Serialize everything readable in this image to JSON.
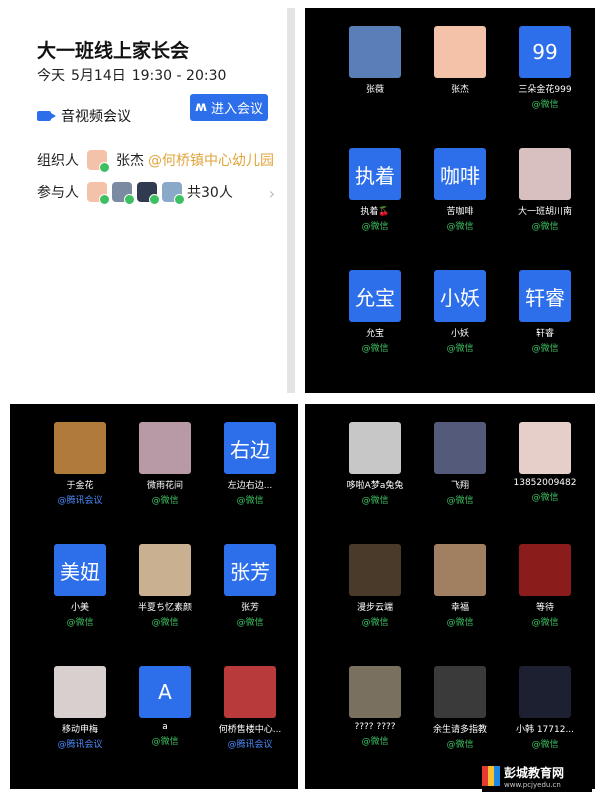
{
  "meeting": {
    "title": "大一班线上家长会",
    "date_day": "今天",
    "date": "5月14日",
    "time": "19:30 - 20:30",
    "type_label": "音视频会议",
    "join_label": "进入会议",
    "organizer_label": "组织人",
    "organizer_name": "张杰",
    "organizer_org": "@何桥镇中心幼儿园",
    "participants_label": "参与人",
    "participants_count": "共30人",
    "accent": "#2d6fea"
  },
  "grid1": [
    {
      "name": "张薇",
      "src": "",
      "thumb": "photo",
      "color": "#5a7fb8"
    },
    {
      "name": "张杰",
      "src": "",
      "thumb": "photo",
      "color": "#f3c2a8"
    },
    {
      "name": "三朵金花999",
      "src": "@微信",
      "thumb": "99",
      "color": "#2d6fea"
    },
    {
      "name": "执着🍒",
      "src": "@微信",
      "thumb": "执着",
      "color": "#2d6fea"
    },
    {
      "name": "苦咖啡",
      "src": "@微信",
      "thumb": "咖啡",
      "color": "#2d6fea"
    },
    {
      "name": "大一班胡川南",
      "src": "@微信",
      "thumb": "photo",
      "color": "#d8c0c0"
    },
    {
      "name": "允宝",
      "src": "@微信",
      "thumb": "允宝",
      "color": "#2d6fea"
    },
    {
      "name": "小妖",
      "src": "@微信",
      "thumb": "小妖",
      "color": "#2d6fea"
    },
    {
      "name": "轩睿",
      "src": "@微信",
      "thumb": "轩睿",
      "color": "#2d6fea"
    }
  ],
  "grid2": [
    {
      "name": "于金花",
      "src": "@腾讯会议",
      "thumb": "photo",
      "color": "#b07a3a"
    },
    {
      "name": "微雨花间",
      "src": "@微信",
      "thumb": "photo",
      "color": "#b89aa6"
    },
    {
      "name": "左边右边...",
      "src": "@微信",
      "thumb": "右边",
      "color": "#2d6fea"
    },
    {
      "name": "小美",
      "src": "@微信",
      "thumb": "美妞",
      "color": "#2d6fea"
    },
    {
      "name": "半夏ち忆素颜",
      "src": "@微信",
      "thumb": "photo",
      "color": "#c9b090"
    },
    {
      "name": "张芳",
      "src": "@微信",
      "thumb": "张芳",
      "color": "#2d6fea"
    },
    {
      "name": "移动申梅",
      "src": "@腾讯会议",
      "thumb": "photo",
      "color": "#d8cfcf"
    },
    {
      "name": "a",
      "src": "@微信",
      "thumb": "A",
      "color": "#2d6fea"
    },
    {
      "name": "何桥售楼中心...",
      "src": "@腾讯会议",
      "thumb": "photo",
      "color": "#b83a3a"
    }
  ],
  "grid3": [
    {
      "name": "哆啦A梦a兔兔",
      "src": "@微信",
      "thumb": "photo",
      "color": "#c7c7c7"
    },
    {
      "name": "飞翔",
      "src": "@微信",
      "thumb": "photo",
      "color": "#545a7a"
    },
    {
      "name": "13852009482",
      "src": "@微信",
      "thumb": "photo",
      "color": "#e6cfc8"
    },
    {
      "name": "漫步云端",
      "src": "@微信",
      "thumb": "photo",
      "color": "#4a3a2a"
    },
    {
      "name": "幸福",
      "src": "@微信",
      "thumb": "photo",
      "color": "#a08060"
    },
    {
      "name": "等待",
      "src": "@微信",
      "thumb": "photo",
      "color": "#8a1c1c"
    },
    {
      "name": "???? ????",
      "src": "@微信",
      "thumb": "photo",
      "color": "#7a7060"
    },
    {
      "name": "余生请多指教",
      "src": "@微信",
      "thumb": "photo",
      "color": "#3a3a3a"
    },
    {
      "name": "小韩 17712...",
      "src": "@微信",
      "thumb": "photo",
      "color": "#1c2030"
    }
  ],
  "logo": {
    "text": "彭城教育网",
    "url": "www.pcjyedu.cn"
  }
}
